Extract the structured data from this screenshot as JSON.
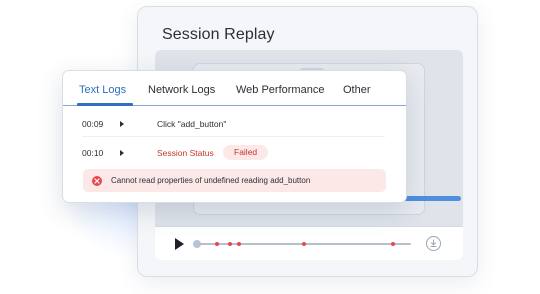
{
  "replay": {
    "title": "Session Replay",
    "controls": {
      "play_icon": "play-icon",
      "download_icon": "download-icon",
      "marker_color": "#e5484d"
    }
  },
  "logs": {
    "tabs": [
      {
        "label": "Text Logs",
        "active": true
      },
      {
        "label": "Network Logs",
        "active": false
      },
      {
        "label": "Web Performance",
        "active": false
      },
      {
        "label": "Other",
        "active": false
      }
    ],
    "rows": [
      {
        "time": "00:09",
        "message": "Click \"add_button\""
      },
      {
        "time": "00:10",
        "message": "Session Status",
        "badge": "Failed"
      }
    ],
    "error": {
      "icon": "error-x-icon",
      "message": "Cannot read properties of undefined reading add_button"
    }
  },
  "colors": {
    "accent": "#2f6fc4",
    "error": "#e5484d",
    "error_background": "#fde8e8"
  }
}
